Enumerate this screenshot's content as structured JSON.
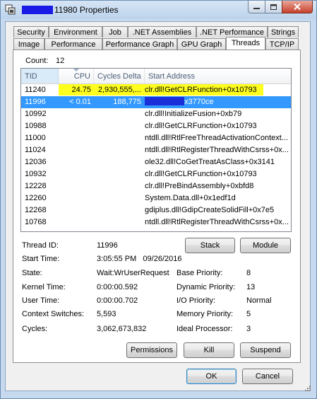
{
  "window": {
    "title": "11980 Properties"
  },
  "tabs_row1": [
    "Security",
    "Environment",
    "Job",
    ".NET Assemblies",
    ".NET Performance",
    "Strings"
  ],
  "tabs_row2": [
    "Image",
    "Performance",
    "Performance Graph",
    "GPU Graph",
    "Threads",
    "TCP/IP"
  ],
  "active_tab": "Threads",
  "count": {
    "label": "Count:",
    "value": "12"
  },
  "columns": [
    "TID",
    "CPU",
    "Cycles Delta",
    "Start Address"
  ],
  "threads": [
    {
      "tid": "11240",
      "cpu": "24.75",
      "cycles": "2,930,555,...",
      "addr": "clr.dll!GetCLRFunction+0x10793"
    },
    {
      "tid": "11996",
      "cpu": "< 0.01",
      "cycles": "188,775",
      "addr": "x3770ce"
    },
    {
      "tid": "10992",
      "cpu": "",
      "cycles": "",
      "addr": "clr.dll!InitializeFusion+0xb79"
    },
    {
      "tid": "10988",
      "cpu": "",
      "cycles": "",
      "addr": "clr.dll!GetCLRFunction+0x10793"
    },
    {
      "tid": "11000",
      "cpu": "",
      "cycles": "",
      "addr": "ntdll.dll!RtlFreeThreadActivationContext..."
    },
    {
      "tid": "11024",
      "cpu": "",
      "cycles": "",
      "addr": "ntdll.dll!RtlRegisterThreadWithCsrss+0x..."
    },
    {
      "tid": "12036",
      "cpu": "",
      "cycles": "",
      "addr": "ole32.dll!CoGetTreatAsClass+0x3141"
    },
    {
      "tid": "10932",
      "cpu": "",
      "cycles": "",
      "addr": "clr.dll!GetCLRFunction+0x10793"
    },
    {
      "tid": "12228",
      "cpu": "",
      "cycles": "",
      "addr": "clr.dll!PreBindAssembly+0xbfd8"
    },
    {
      "tid": "12260",
      "cpu": "",
      "cycles": "",
      "addr": "System.Data.dll+0x1edf1d"
    },
    {
      "tid": "12268",
      "cpu": "",
      "cycles": "",
      "addr": "gdiplus.dll!GdipCreateSolidFill+0x7e5"
    },
    {
      "tid": "10768",
      "cpu": "",
      "cycles": "",
      "addr": "ntdll.dll!RtlRegisterThreadWithCsrss+0x..."
    }
  ],
  "selected_row": 1,
  "highlighted_row": 0,
  "details": {
    "thread_id_label": "Thread ID:",
    "thread_id": "11996",
    "start_time_label": "Start Time:",
    "start_time": "3:05:55 PM   09/26/2016",
    "state_label": "State:",
    "state": "Wait:WrUserRequest",
    "base_priority_label": "Base Priority:",
    "base_priority": "8",
    "kernel_time_label": "Kernel Time:",
    "kernel_time": "0:00:00.592",
    "dynamic_priority_label": "Dynamic Priority:",
    "dynamic_priority": "13",
    "user_time_label": "User Time:",
    "user_time": "0:00:00.702",
    "io_priority_label": "I/O Priority:",
    "io_priority": "Normal",
    "context_switches_label": "Context Switches:",
    "context_switches": "5,593",
    "memory_priority_label": "Memory Priority:",
    "memory_priority": "5",
    "cycles_label": "Cycles:",
    "cycles": "3,062,673,832",
    "ideal_processor_label": "Ideal Processor:",
    "ideal_processor": "3"
  },
  "buttons": {
    "stack": "Stack",
    "module": "Module",
    "permissions": "Permissions",
    "kill": "Kill",
    "suspend": "Suspend",
    "ok": "OK",
    "cancel": "Cancel"
  },
  "colors": {
    "selection": "#3399ff",
    "highlight": "#ffff1f",
    "redaction": "#1a1ae6"
  }
}
